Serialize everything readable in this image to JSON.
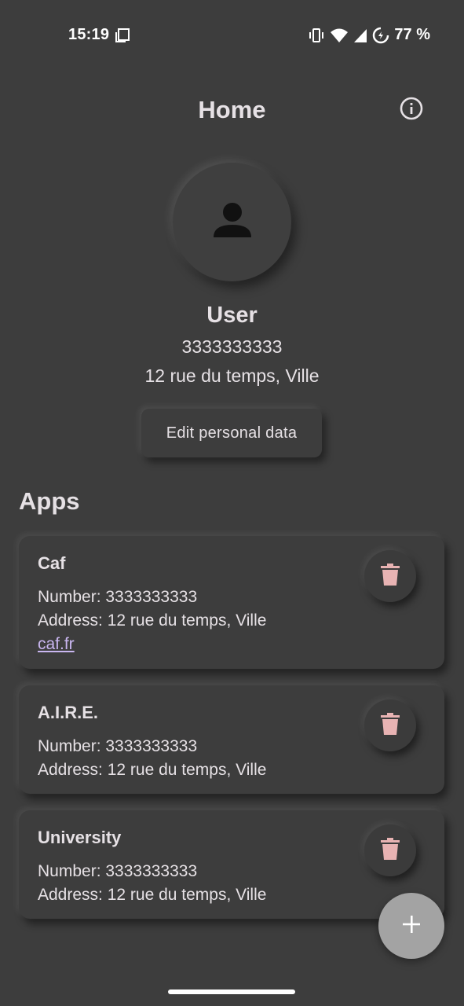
{
  "status_bar": {
    "time": "15:19",
    "battery": "77 %",
    "icons": [
      "document-icon",
      "vibrate-icon",
      "wifi-icon",
      "signal-icon",
      "battery-saver-icon"
    ]
  },
  "app_bar": {
    "title": "Home",
    "info_icon": "info-icon"
  },
  "profile": {
    "avatar_icon": "person-icon",
    "name": "User",
    "phone": "3333333333",
    "address": "12 rue du temps, Ville",
    "edit_button_label": "Edit personal data"
  },
  "apps_section": {
    "title": "Apps",
    "items": [
      {
        "name": "Caf",
        "number": "Number: 3333333333",
        "address": "Address: 12 rue du temps, Ville",
        "link": "caf.fr"
      },
      {
        "name": "A.I.R.E.",
        "number": "Number: 3333333333",
        "address": "Address: 12 rue du temps, Ville"
      },
      {
        "name": "University",
        "number": "Number: 3333333333",
        "address": "Address: 12 rue du temps, Ville"
      }
    ],
    "delete_icon": "trash-icon",
    "delete_icon_color": "#e8b3b3"
  },
  "fab": {
    "icon": "plus-icon",
    "color": "#a3a3a3"
  },
  "colors": {
    "background": "#3d3d3d",
    "text": "#e6e1e5",
    "link": "#c9b6f0"
  }
}
